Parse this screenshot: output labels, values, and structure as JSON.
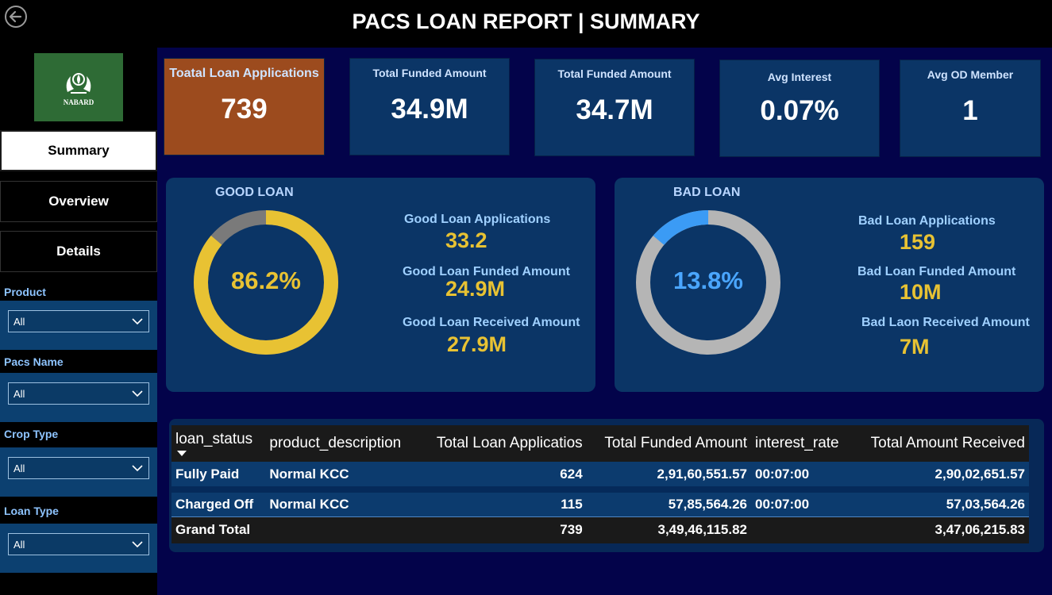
{
  "header": {
    "title": "PACS LOAN REPORT | SUMMARY",
    "back_icon": "back-arrow-icon"
  },
  "sidebar": {
    "logo_text": "NABARD",
    "nav": [
      {
        "label": "Summary",
        "active": true
      },
      {
        "label": "Overview",
        "active": false
      },
      {
        "label": "Details",
        "active": false
      }
    ],
    "filters": [
      {
        "label": "Product",
        "value": "All"
      },
      {
        "label": "Pacs Name",
        "value": "All"
      },
      {
        "label": "Crop Type",
        "value": "All"
      },
      {
        "label": "Loan Type",
        "value": "All"
      }
    ]
  },
  "kpis": [
    {
      "label": "Toatal Loan Applications",
      "value": "739"
    },
    {
      "label": "Total Funded Amount",
      "value": "34.9M"
    },
    {
      "label": "Total Funded Amount",
      "value": "34.7M"
    },
    {
      "label": "Avg Interest",
      "value": "0.07%"
    },
    {
      "label": "Avg OD Member",
      "value": "1"
    }
  ],
  "good_loan": {
    "title": "GOOD LOAN",
    "percent_label": "86.2%",
    "percent": 86.2,
    "colors": {
      "main": "#e8c233",
      "rest": "#7a7a7a",
      "text": "#e8c233"
    },
    "stats": [
      {
        "label": "Good Loan Applications",
        "value": "33.2"
      },
      {
        "label": "Good Loan Funded Amount",
        "value": "24.9M"
      },
      {
        "label": "Good Loan Received Amount",
        "value": "27.9M"
      }
    ]
  },
  "bad_loan": {
    "title": "BAD LOAN",
    "percent_label": "13.8%",
    "percent": 13.8,
    "colors": {
      "main": "#3b9bf5",
      "rest": "#b5b5b5",
      "text": "#4aa6ff"
    },
    "stats": [
      {
        "label": "Bad Loan Applications",
        "value": "159"
      },
      {
        "label": "Bad Loan Funded Amount",
        "value": "10M"
      },
      {
        "label": "Bad Laon Received Amount",
        "value": "7M"
      }
    ]
  },
  "table": {
    "columns": [
      "loan_status",
      "product_description",
      "Total Loan Applicatios",
      "Total Funded Amount",
      "interest_rate",
      "Total Amount Received"
    ],
    "rows": [
      [
        "Fully Paid",
        "Normal KCC",
        "624",
        "2,91,60,551.57",
        "00:07:00",
        "2,90,02,651.57"
      ],
      [
        "Charged Off",
        "Normal KCC",
        "115",
        "57,85,564.26",
        "00:07:00",
        "57,03,564.26"
      ]
    ],
    "total": [
      "Grand Total",
      "",
      "739",
      "3,49,46,115.82",
      "",
      "3,47,06,215.83"
    ]
  }
}
